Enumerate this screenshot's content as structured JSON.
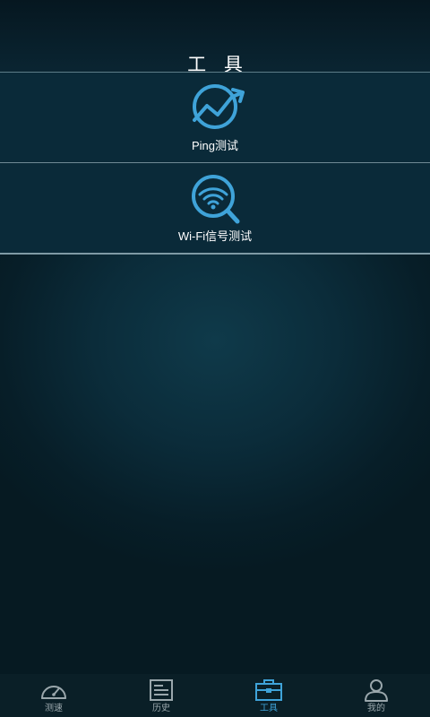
{
  "header": {
    "title": "工 具"
  },
  "tools": [
    {
      "label": "Ping测试",
      "icon": "ping-chart-icon"
    },
    {
      "label": "Wi-Fi信号测试",
      "icon": "wifi-search-icon"
    }
  ],
  "tabbar": {
    "items": [
      {
        "label": "测速",
        "icon": "speedometer-icon",
        "active": false
      },
      {
        "label": "历史",
        "icon": "document-icon",
        "active": false
      },
      {
        "label": "工具",
        "icon": "toolbox-icon",
        "active": true
      },
      {
        "label": "我的",
        "icon": "user-icon",
        "active": false
      }
    ]
  },
  "colors": {
    "accent": "#3fa3d9",
    "background": "#0b2c3a",
    "inactive": "#9aa7ac"
  }
}
